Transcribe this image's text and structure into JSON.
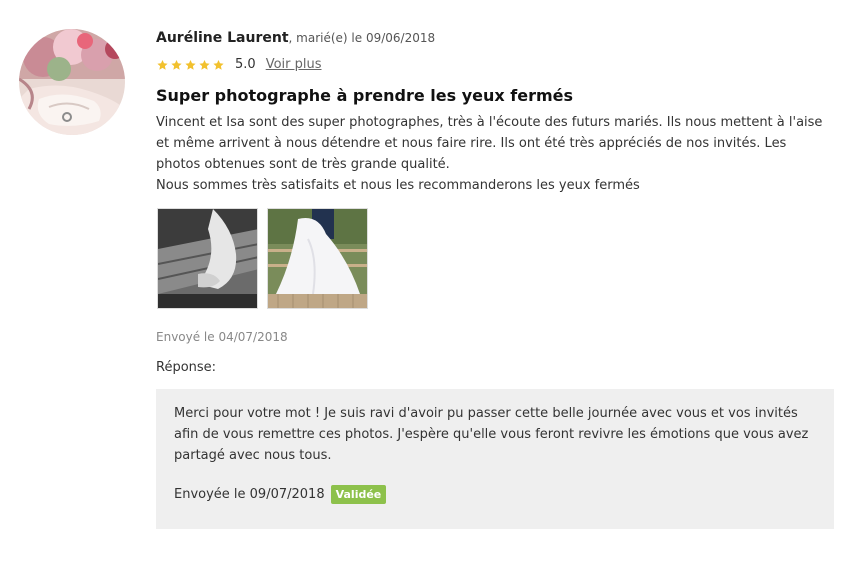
{
  "review": {
    "author_name": "Auréline Laurent",
    "author_meta": ", marié(e) le 09/06/2018",
    "rating_score": "5.0",
    "rating_value": 5,
    "rating_max": 5,
    "more_link": "Voir plus",
    "title": "Super photographe à prendre les yeux fermés",
    "body_lines": [
      "Vincent et Isa sont des super photographes, très à l'écoute des futurs mariés. Ils nous mettent à l'aise et même arrivent à nous détendre et nous faire rire. Ils ont été très appréciés de nos invités. Les photos obtenues sont de très grande qualité.",
      "Nous sommes très satisfaits et nous les recommanderons les yeux fermés"
    ],
    "sent_date": "Envoyé le 04/07/2018"
  },
  "reply": {
    "label": "Réponse:",
    "text": "Merci pour votre mot ! Je suis ravi d'avoir pu passer cette belle journée avec vous et vos invités afin de vous remettre ces photos. J'espère qu'elle vous feront revivre les émotions que vous avez partagé avec nous tous.",
    "sent_date": "Envoyée le 09/07/2018",
    "status_badge": "Validée"
  },
  "colors": {
    "star": "#f2c12e",
    "badge": "#8dc14b",
    "reply_bg": "#efefef"
  }
}
